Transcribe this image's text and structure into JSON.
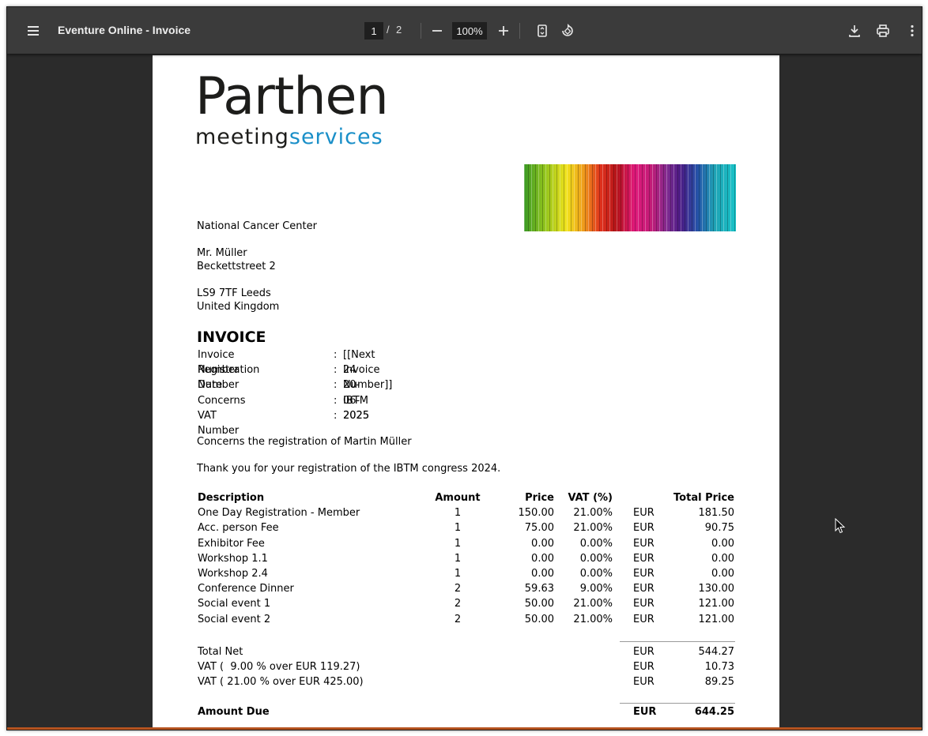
{
  "toolbar": {
    "title": "Eventure Online - Invoice",
    "page_current": "1",
    "page_separator": "/",
    "page_total": "2",
    "zoom": "100%"
  },
  "icons": {
    "menu": "hamburger-menu-icon",
    "zoom_out": "minus-icon",
    "zoom_in": "plus-icon",
    "fit": "fit-page-icon",
    "rotate": "rotate-icon",
    "download": "download-icon",
    "print": "printer-icon",
    "more": "more-vertical-icon"
  },
  "logo": {
    "word": "Parthen",
    "sub_a": "meeting",
    "sub_b": "services",
    "brand_color": "#1a8fc8"
  },
  "recipient": {
    "organisation": "National Cancer Center",
    "name": "Mr. Müller",
    "street": "Beckettstreet 2",
    "city": "LS9 7TF Leeds",
    "country": "United Kingdom"
  },
  "invoice": {
    "heading": "INVOICE",
    "meta": [
      {
        "label": "Invoice Number",
        "value": "[[Next Invoice Number]]"
      },
      {
        "label": "Registration Number",
        "value": "24"
      },
      {
        "label": "Date",
        "value": "20-06-2025"
      },
      {
        "label": "Concerns",
        "value": "IBTM 2025"
      },
      {
        "label": "VAT Number",
        "value": ""
      }
    ],
    "colon": ":",
    "concerns_line": "Concerns the registration of Martin Müller",
    "thanks_line": "Thank you for your registration of the IBTM congress 2024."
  },
  "items": {
    "headers": {
      "description": "Description",
      "amount": "Amount",
      "price": "Price",
      "vat": "VAT (%)",
      "total": "Total Price"
    },
    "rows": [
      {
        "description": "One Day Registration - Member",
        "amount": "1",
        "price": "150.00",
        "vat": "21.00%",
        "currency": "EUR",
        "total": "181.50"
      },
      {
        "description": "Acc. person Fee",
        "amount": "1",
        "price": "75.00",
        "vat": "21.00%",
        "currency": "EUR",
        "total": "90.75"
      },
      {
        "description": "Exhibitor Fee",
        "amount": "1",
        "price": "0.00",
        "vat": "0.00%",
        "currency": "EUR",
        "total": "0.00"
      },
      {
        "description": "Workshop 1.1",
        "amount": "1",
        "price": "0.00",
        "vat": "0.00%",
        "currency": "EUR",
        "total": "0.00"
      },
      {
        "description": "Workshop 2.4",
        "amount": "1",
        "price": "0.00",
        "vat": "0.00%",
        "currency": "EUR",
        "total": "0.00"
      },
      {
        "description": "Conference Dinner",
        "amount": "2",
        "price": "59.63",
        "vat": "9.00%",
        "currency": "EUR",
        "total": "130.00"
      },
      {
        "description": "Social event 1",
        "amount": "2",
        "price": "50.00",
        "vat": "21.00%",
        "currency": "EUR",
        "total": "121.00"
      },
      {
        "description": "Social event 2",
        "amount": "2",
        "price": "50.00",
        "vat": "21.00%",
        "currency": "EUR",
        "total": "121.00"
      }
    ]
  },
  "totals": {
    "rows": [
      {
        "label": "Total Net",
        "currency": "EUR",
        "value": "544.27"
      },
      {
        "label": "VAT (  9.00 % over EUR 119.27)",
        "currency": "EUR",
        "value": "10.73"
      },
      {
        "label": "VAT ( 21.00 % over EUR 425.00)",
        "currency": "EUR",
        "value": "89.25"
      }
    ],
    "amount_due": {
      "label": "Amount Due",
      "currency": "EUR",
      "value": "644.25"
    }
  }
}
